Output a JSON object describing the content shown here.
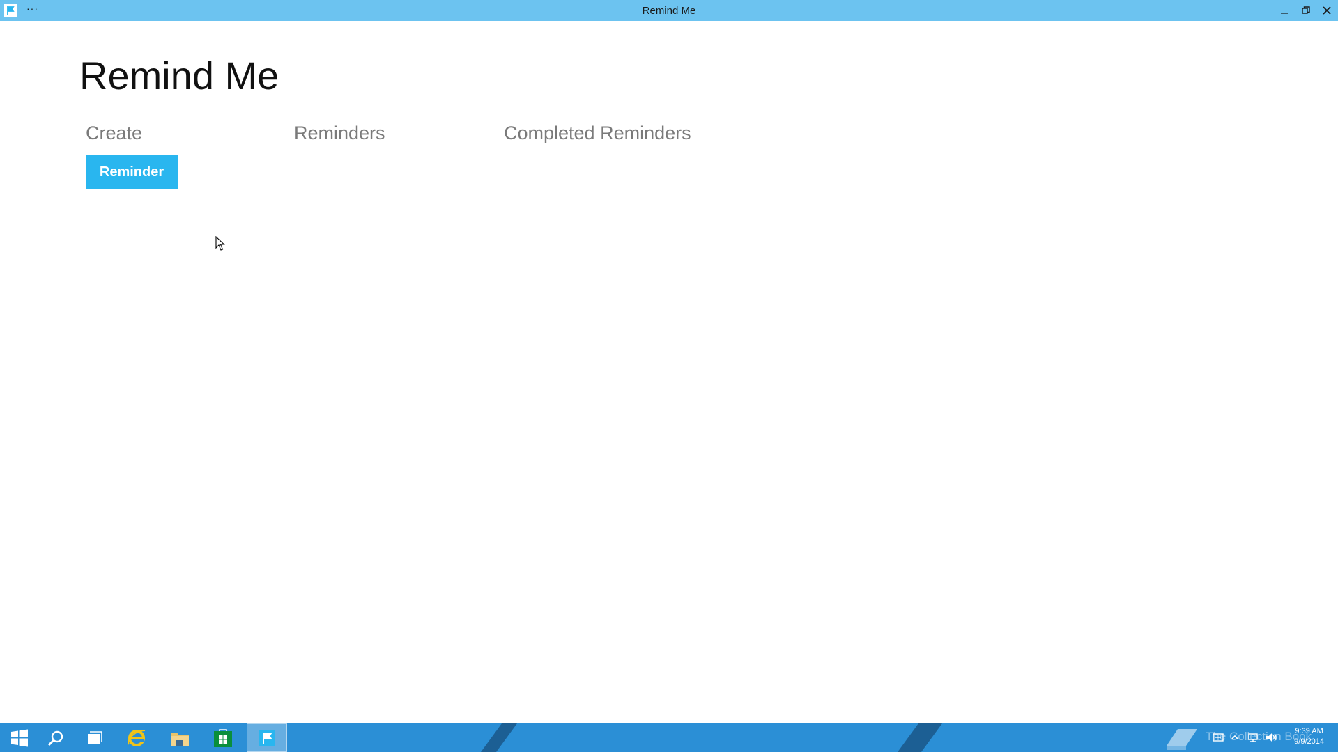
{
  "window": {
    "title": "Remind Me",
    "more_label": "···"
  },
  "page": {
    "title": "Remind Me"
  },
  "sections": {
    "create": "Create",
    "reminders": "Reminders",
    "completed": "Completed Reminders"
  },
  "actions": {
    "reminder_button": "Reminder"
  },
  "taskbar": {
    "watermark": "The Collection Book",
    "time": "9:39 AM",
    "date": "9/9/2014"
  },
  "colors": {
    "titlebar": "#6cc3f0",
    "accent_button": "#29b6ef",
    "taskbar": "#2b8fd6"
  },
  "icons": {
    "app": "flag-icon",
    "minimize": "minimize-icon",
    "restore": "restore-icon",
    "close": "close-icon",
    "start": "windows-logo-icon",
    "search": "search-icon",
    "task_view": "task-view-icon",
    "browser": "internet-explorer-icon",
    "explorer": "file-explorer-icon",
    "store": "store-icon",
    "remind_me": "flag-icon"
  }
}
